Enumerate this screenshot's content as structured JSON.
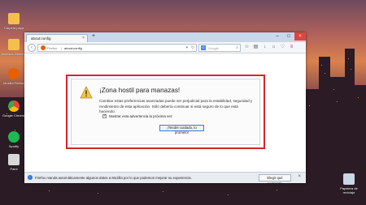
{
  "desktop": {
    "icons": [
      {
        "label": "Carpeta papa",
        "icon": "folder-icon",
        "color": "#f3c14b"
      },
      {
        "label": "Accesos Directos",
        "icon": "folder-icon",
        "color": "#f3c14b"
      },
      {
        "label": "Mozilla Firefox",
        "icon": "firefox-icon",
        "color": "#e66000"
      },
      {
        "label": "Google Chrome",
        "icon": "chrome-icon",
        "color": "#34a853"
      },
      {
        "label": "Spotify",
        "icon": "spotify-icon",
        "color": "#1db954"
      },
      {
        "label": "Paint",
        "icon": "paint-icon",
        "color": "#d8d8d8"
      },
      {
        "label": "Papelera de reciclaje",
        "icon": "recycle-bin-icon",
        "color": "#c9d6e6"
      }
    ]
  },
  "browser": {
    "tab_title": "about:config",
    "tab_close": "×",
    "new_tab": "+",
    "window_controls": {
      "minimize": "–",
      "maximize": "□",
      "close": "×"
    },
    "url_brand": "Firefox",
    "url_text": "about:config",
    "search_placeholder": "Google",
    "search_engine_letter": "G"
  },
  "warning": {
    "title": "¡Zona hostil para manazas!",
    "body": "Cambiar estas preferencias avanzadas puede ser perjudicial para la estabilidad, seguridad y rendimiento de esta aplicación. Sólo debería continuar si está seguro de lo que está haciendo.",
    "checkbox_label": "Mostrar esta advertencia la próxima vez",
    "checkbox_checked": true,
    "button_label": "¡Tendré cuidado, lo prometo!"
  },
  "notification": {
    "message": "Firefox manda automáticamente algunos datos a Mozilla por lo que podemos mejorar su experiencia.",
    "button_label": "Elegir qué comparto",
    "close": "×",
    "info_glyph": "i"
  },
  "colors": {
    "accent": "#d7232b",
    "button_border": "#3b7bd4",
    "firefox": "#e66000"
  }
}
